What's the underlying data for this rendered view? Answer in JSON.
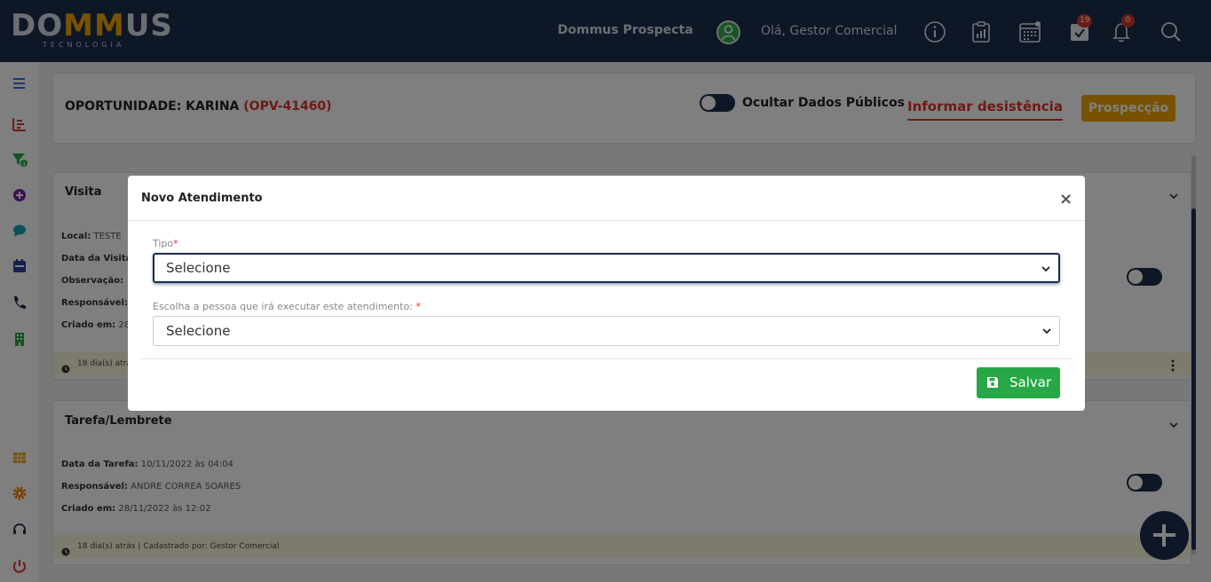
{
  "header": {
    "logo_main_left": "DO",
    "logo_main_accent": "MM",
    "logo_main_right": "US",
    "logo_sub": "TECNOLOGIA",
    "app_name": "Dommus Prospecta",
    "greeting": "Olá, Gestor Comercial",
    "icons": [
      "user-avatar-icon",
      "info-icon",
      "report-icon",
      "calendar-icon",
      "task-check-icon",
      "bell-icon",
      "search-icon"
    ],
    "tasks_badge": "19",
    "notifications_badge": "0"
  },
  "sidebar": {
    "icons": [
      "menu-icon",
      "chart-icon",
      "filter-dollar-icon",
      "add-circle-icon",
      "chat-icon",
      "calendar-icon",
      "phone-icon",
      "building-icon",
      "grid-icon",
      "gear-icon",
      "headset-icon",
      "power-icon"
    ]
  },
  "opportunity": {
    "title_label": "OPORTUNIDADE: KARINA",
    "code": "(OPV-41460)",
    "toggle_label": "Ocultar Dados Públicos",
    "desist_link": "Informar desistência",
    "stage_button": "Prospecção"
  },
  "visita": {
    "title": "Visita",
    "local_label": "Local:",
    "local_value": "TESTE",
    "data_label": "Data da Visita",
    "obs_label": "Observação:",
    "resp_label": "Responsável:",
    "criado_label": "Criado em:",
    "criado_value": "28",
    "footer": "18 dia(s) atrá"
  },
  "tarefa": {
    "title": "Tarefa/Lembrete",
    "data_label": "Data da Tarefa:",
    "data_value": "10/11/2022 às 04:04",
    "resp_label": "Responsável:",
    "resp_value": "ANDRE CORREA SOARES",
    "criado_label": "Criado em:",
    "criado_value": "28/11/2022 às 12:02",
    "footer": "18 dia(s) atrás | Cadastrado por: Gestor Comercial"
  },
  "modal": {
    "title": "Novo Atendimento",
    "close": "×",
    "tipo_label": "Tipo",
    "tipo_value": "Selecione",
    "pessoa_label": "Escolha a pessoa que irá executar este atendimento:",
    "pessoa_value": "Selecione",
    "required_mark": "*",
    "save_button": "Salvar"
  },
  "colors": {
    "navy": "#1a2f4d",
    "accent_orange": "#f0a500",
    "danger_red": "#d9342b",
    "success_green": "#27a745"
  }
}
